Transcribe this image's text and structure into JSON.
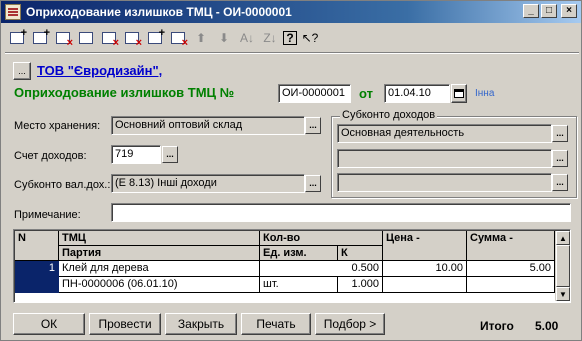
{
  "window": {
    "title": "Оприходование излишков ТМЦ - ОИ-0000001",
    "buttons": {
      "minimize": "_",
      "maximize": "□",
      "close": "×"
    }
  },
  "toolbar": {
    "icons": [
      "new-row-icon",
      "copy-row-icon",
      "delete-row-icon",
      "edit-row-icon",
      "delete-mark-icon",
      "delete-mark-copy-icon",
      "new-group-icon",
      "insert-row-icon",
      "move-up-icon",
      "move-down-icon",
      "sort-asc-icon",
      "sort-desc-icon",
      "help-icon",
      "context-help-icon"
    ],
    "glyphs": {
      "up": "⬆",
      "down": "⬇",
      "sort_asc": "A↓",
      "sort_desc": "Z↓",
      "help": "?",
      "ctx_help": "↖?"
    }
  },
  "header": {
    "company": "ТОВ \"Євродизайн\",",
    "doc_title": "Оприходование излишков ТМЦ №",
    "doc_number": "ОИ-0000001",
    "date_label": "от",
    "date": "01.04.10",
    "user": "Інна"
  },
  "form": {
    "storage_label": "Место хранения:",
    "storage_value": "Основний оптовий склад",
    "income_account_label": "Счет доходов:",
    "income_account_value": "719",
    "subconto_label": "Субконто вал.дох.:",
    "subconto_value": "(Е 8.13) Інші доходи",
    "income_subconto_legend": "Субконто доходов",
    "income_subconto_1": "Основная деятельность",
    "income_subconto_2": "",
    "income_subconto_3": "",
    "note_label": "Примечание:",
    "note_value": ""
  },
  "table": {
    "headers": {
      "n": "N",
      "tmc": "ТМЦ",
      "batch": "Партия",
      "qty": "Кол-во",
      "unit": "Ед. изм.",
      "k": "К",
      "price": "Цена -",
      "sum": "Сумма -"
    },
    "rows": [
      {
        "n": "1",
        "tmc": "Клей для дерева",
        "batch": "ПН-0000006 (06.01.10)",
        "qty": "0.500",
        "unit": "шт.",
        "k": "1.000",
        "price": "10.00",
        "sum": "5.00"
      }
    ]
  },
  "footer": {
    "ok": "ОК",
    "post": "Провести",
    "close": "Закрыть",
    "print": "Печать",
    "select": "Подбор >",
    "total_label": "Итого",
    "total_value": "5.00"
  },
  "colors": {
    "title_bar": "#0a246a",
    "company": "#0000cc",
    "doc_title": "#008000",
    "selected_row": "#0a246a"
  }
}
